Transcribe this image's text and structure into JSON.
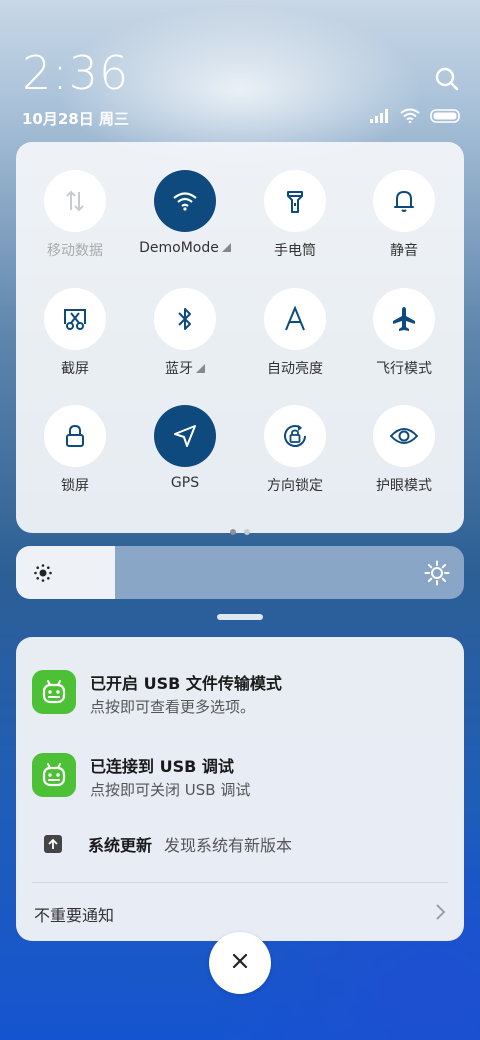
{
  "status": {
    "time": "2:36",
    "date": "10月28日 周三"
  },
  "quick_settings": {
    "tiles": [
      {
        "label": "移动数据",
        "icon": "mobile-data-icon",
        "active": false,
        "disabled": true
      },
      {
        "label": "DemoMode",
        "icon": "wifi-icon",
        "active": true,
        "has_more": true
      },
      {
        "label": "手电筒",
        "icon": "flashlight-icon",
        "active": false
      },
      {
        "label": "静音",
        "icon": "bell-icon",
        "active": false
      },
      {
        "label": "截屏",
        "icon": "screenshot-icon",
        "active": false
      },
      {
        "label": "蓝牙",
        "icon": "bluetooth-icon",
        "active": false,
        "has_more": true
      },
      {
        "label": "自动亮度",
        "icon": "auto-brightness-icon",
        "active": false
      },
      {
        "label": "飞行模式",
        "icon": "airplane-icon",
        "active": false
      },
      {
        "label": "锁屏",
        "icon": "lock-icon",
        "active": false
      },
      {
        "label": "GPS",
        "icon": "location-arrow-icon",
        "active": true
      },
      {
        "label": "方向锁定",
        "icon": "rotation-lock-icon",
        "active": false
      },
      {
        "label": "护眼模式",
        "icon": "eye-icon",
        "active": false
      }
    ],
    "page_count": 2,
    "current_page": 1
  },
  "brightness": {
    "level": 0.22
  },
  "notifications": {
    "items": [
      {
        "title": "已开启 USB 文件传输模式",
        "body": "点按即可查看更多选项。"
      },
      {
        "title": "已连接到 USB 调试",
        "body": "点按即可关闭 USB 调试"
      }
    ],
    "update": {
      "title": "系统更新",
      "text": "发现系统有新版本"
    },
    "unimportant_label": "不重要通知"
  },
  "colors": {
    "active_tile": "#0e4a7e",
    "app_icon_green": "#4cc136"
  }
}
